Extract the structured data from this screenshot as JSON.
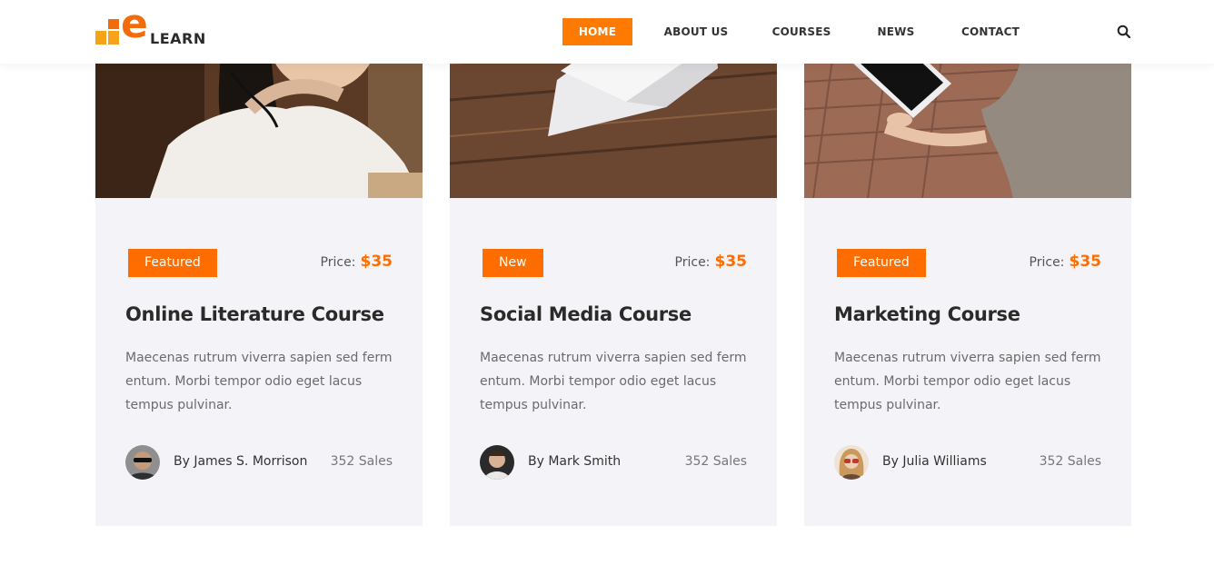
{
  "header": {
    "logo": {
      "mark": "e",
      "text": "LEARN"
    },
    "nav": [
      {
        "label": "HOME",
        "active": true
      },
      {
        "label": "ABOUT US",
        "active": false
      },
      {
        "label": "COURSES",
        "active": false
      },
      {
        "label": "NEWS",
        "active": false
      },
      {
        "label": "CONTACT",
        "active": false
      }
    ],
    "search_icon": "search-icon"
  },
  "colors": {
    "accent": "#ff6d00",
    "logo_orange": "#f26b0c",
    "logo_yellow": "#f7a21b",
    "card_bg": "#f4f3f8"
  },
  "courses": [
    {
      "badge": "Featured",
      "price_label": "Price:",
      "price": "$35",
      "title": "Online Literature Course",
      "description": "Maecenas rutrum viverra sapien sed ferm entum. Morbi tempor odio eget lacus tempus pulvinar.",
      "author": "By James S. Morrison",
      "sales": "352 Sales"
    },
    {
      "badge": "New",
      "price_label": "Price:",
      "price": "$35",
      "title": "Social Media Course",
      "description": "Maecenas rutrum viverra sapien sed ferm entum. Morbi tempor odio eget lacus tempus pulvinar.",
      "author": "By Mark Smith",
      "sales": "352 Sales"
    },
    {
      "badge": "Featured",
      "price_label": "Price:",
      "price": "$35",
      "title": "Marketing Course",
      "description": "Maecenas rutrum viverra sapien sed ferm entum. Morbi tempor odio eget lacus tempus pulvinar.",
      "author": "By Julia Williams",
      "sales": "352 Sales"
    }
  ]
}
